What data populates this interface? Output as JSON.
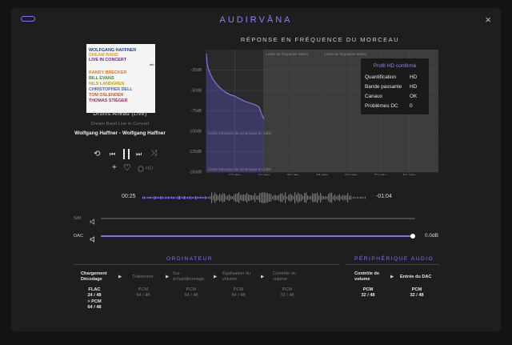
{
  "window": {
    "title": "AUDIRVĀNA",
    "close_icon": "×"
  },
  "cover": {
    "lines": [
      {
        "text": "WOLFGANG HAFFNER",
        "color": "#1f3f8a"
      },
      {
        "text": "DREAM BAND",
        "color": "#e0a020"
      },
      {
        "text": "LIVE IN CONCERT",
        "color": "#6a2a88"
      },
      {
        "text": "RANDY BRECKER",
        "color": "#e07a1a"
      },
      {
        "text": "BILL EVANS",
        "color": "#4a8a2a"
      },
      {
        "text": "NILS LANDGREN",
        "color": "#c8a018"
      },
      {
        "text": "CHRISTOPHER DELL",
        "color": "#4a6ab0"
      },
      {
        "text": "TOM OSLENDER",
        "color": "#d05a2a"
      },
      {
        "text": "THOMAS STIEGER",
        "color": "#a02a6a"
      }
    ],
    "badge": "wh"
  },
  "track": {
    "title": "Drums Ahead (Live)",
    "album": "Dream Band Live in Concert",
    "artist": "Wolfgang Haffner - Wolfgang Haffner"
  },
  "controls": {
    "repeat_icon": "⟲",
    "prev_icon": "⏮",
    "pause_icon": "⏸",
    "next_icon": "⏭",
    "shuffle_icon": "⤨",
    "add_icon": "+",
    "heart_icon": "♡",
    "hd_label": "HD"
  },
  "frequency": {
    "title": "RÉPONSE EN FRÉQUENCE DU MORCEAU",
    "y_labels": [
      "-25dB",
      "-50dB",
      "-75dB",
      "-100dB",
      "-125dB",
      "-150dB"
    ],
    "x_labels": [
      "12 kHz",
      "24 kHz",
      "36 kHz",
      "48 kHz",
      "60 kHz",
      "72 kHz",
      "84 kHz"
    ],
    "limit_48": "Limite de fréquence 48kHz",
    "limit_96": "Limite de fréquence 96kHz",
    "limit_16bit": "Limite théorique de dynamique en 16bit",
    "limit_24bit": "Limite théorique de dynamique en 24bit",
    "popup": {
      "title": "Profil HD confirmé",
      "rows": [
        {
          "label": "Quantification",
          "value": "HD"
        },
        {
          "label": "Bande passante",
          "value": "HD"
        },
        {
          "label": "Canaux",
          "value": "OK"
        },
        {
          "label": "Problèmes DC",
          "value": "0"
        }
      ]
    }
  },
  "chart_data": {
    "type": "area",
    "title": "RÉPONSE EN FRÉQUENCE DU MORCEAU",
    "xlabel": "",
    "ylabel": "",
    "x_unit": "kHz",
    "xlim": [
      0,
      96
    ],
    "ylim": [
      -150,
      0
    ],
    "x_ticks": [
      12,
      24,
      36,
      48,
      60,
      72,
      84
    ],
    "y_ticks": [
      -25,
      -50,
      -75,
      -100,
      -125,
      -150
    ],
    "series": [
      {
        "x": [
          0.3,
          0.6,
          1,
          1.5,
          2,
          3,
          4,
          5,
          6,
          8,
          10,
          12,
          14,
          16,
          18,
          20,
          22,
          23,
          24
        ],
        "y": [
          -5,
          -16,
          -22,
          -26,
          -30,
          -36,
          -40,
          -44,
          -47,
          -52,
          -55,
          -57,
          -60,
          -63,
          -65,
          -67,
          -70,
          -78,
          -85
        ]
      }
    ]
  },
  "playback": {
    "elapsed": "00:25",
    "remaining": "-01:04",
    "progress": 0.28
  },
  "volume": {
    "sw_label": "SW",
    "dac_label": "DAC",
    "speaker_icon": "speaker",
    "sw_level": 0,
    "dac_level": 1.0,
    "dac_value": "0.0dB"
  },
  "pipeline": {
    "computer_header": "ORDINATEUR",
    "device_header": "PÉRIPHÉRIQUE AUDIO",
    "stages": [
      {
        "label": "Chargement\nDécodage",
        "format": "FLAC\n24 / 48\n> PCM\n64 / 48",
        "active": true
      },
      {
        "label": "Traitement",
        "format": "PCM\n64 / 48",
        "active": false
      },
      {
        "label": "Sur-\néchantillonnage",
        "format": "PCM\n64 / 48",
        "active": false
      },
      {
        "label": "Égalisation du\nvolume",
        "format": "PCM\n64 / 48",
        "active": false
      },
      {
        "label": "Contrôle du\nvolume",
        "format": "PCM\n32 / 48",
        "active": false
      },
      {
        "label": "Contrôle de\nvolume",
        "format": "PCM\n32 / 48",
        "active": true
      },
      {
        "label": "Entrée du DAC",
        "format": "PCM\n32 / 48",
        "active": true
      }
    ],
    "arrow_icon": "▶"
  }
}
